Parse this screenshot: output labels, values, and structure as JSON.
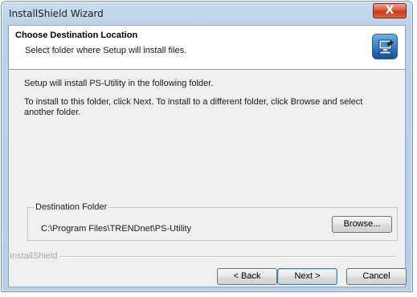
{
  "window": {
    "title": "InstallShield Wizard",
    "close_glyph": "X"
  },
  "header": {
    "title": "Choose Destination Location",
    "subtitle": "Select folder where Setup will install files.",
    "icon": "installer-computer-icon"
  },
  "body": {
    "line1": "Setup will install PS-Utility in the following folder.",
    "line2": "To install to this folder, click Next. To install to a different folder, click Browse and select another folder."
  },
  "destination": {
    "group_label": "Destination Folder",
    "path": "C:\\Program Files\\TRENDnet\\PS-Utility",
    "browse_label": "Browse..."
  },
  "footer": {
    "brand": "InstallShield",
    "back_label": "< Back",
    "next_label": "Next >",
    "cancel_label": "Cancel"
  },
  "colors": {
    "titlebar": "#bcd3e8",
    "close_button": "#c33a1c",
    "dialog_background": "#f0f0f0",
    "default_button_border": "#3c7fb1"
  }
}
